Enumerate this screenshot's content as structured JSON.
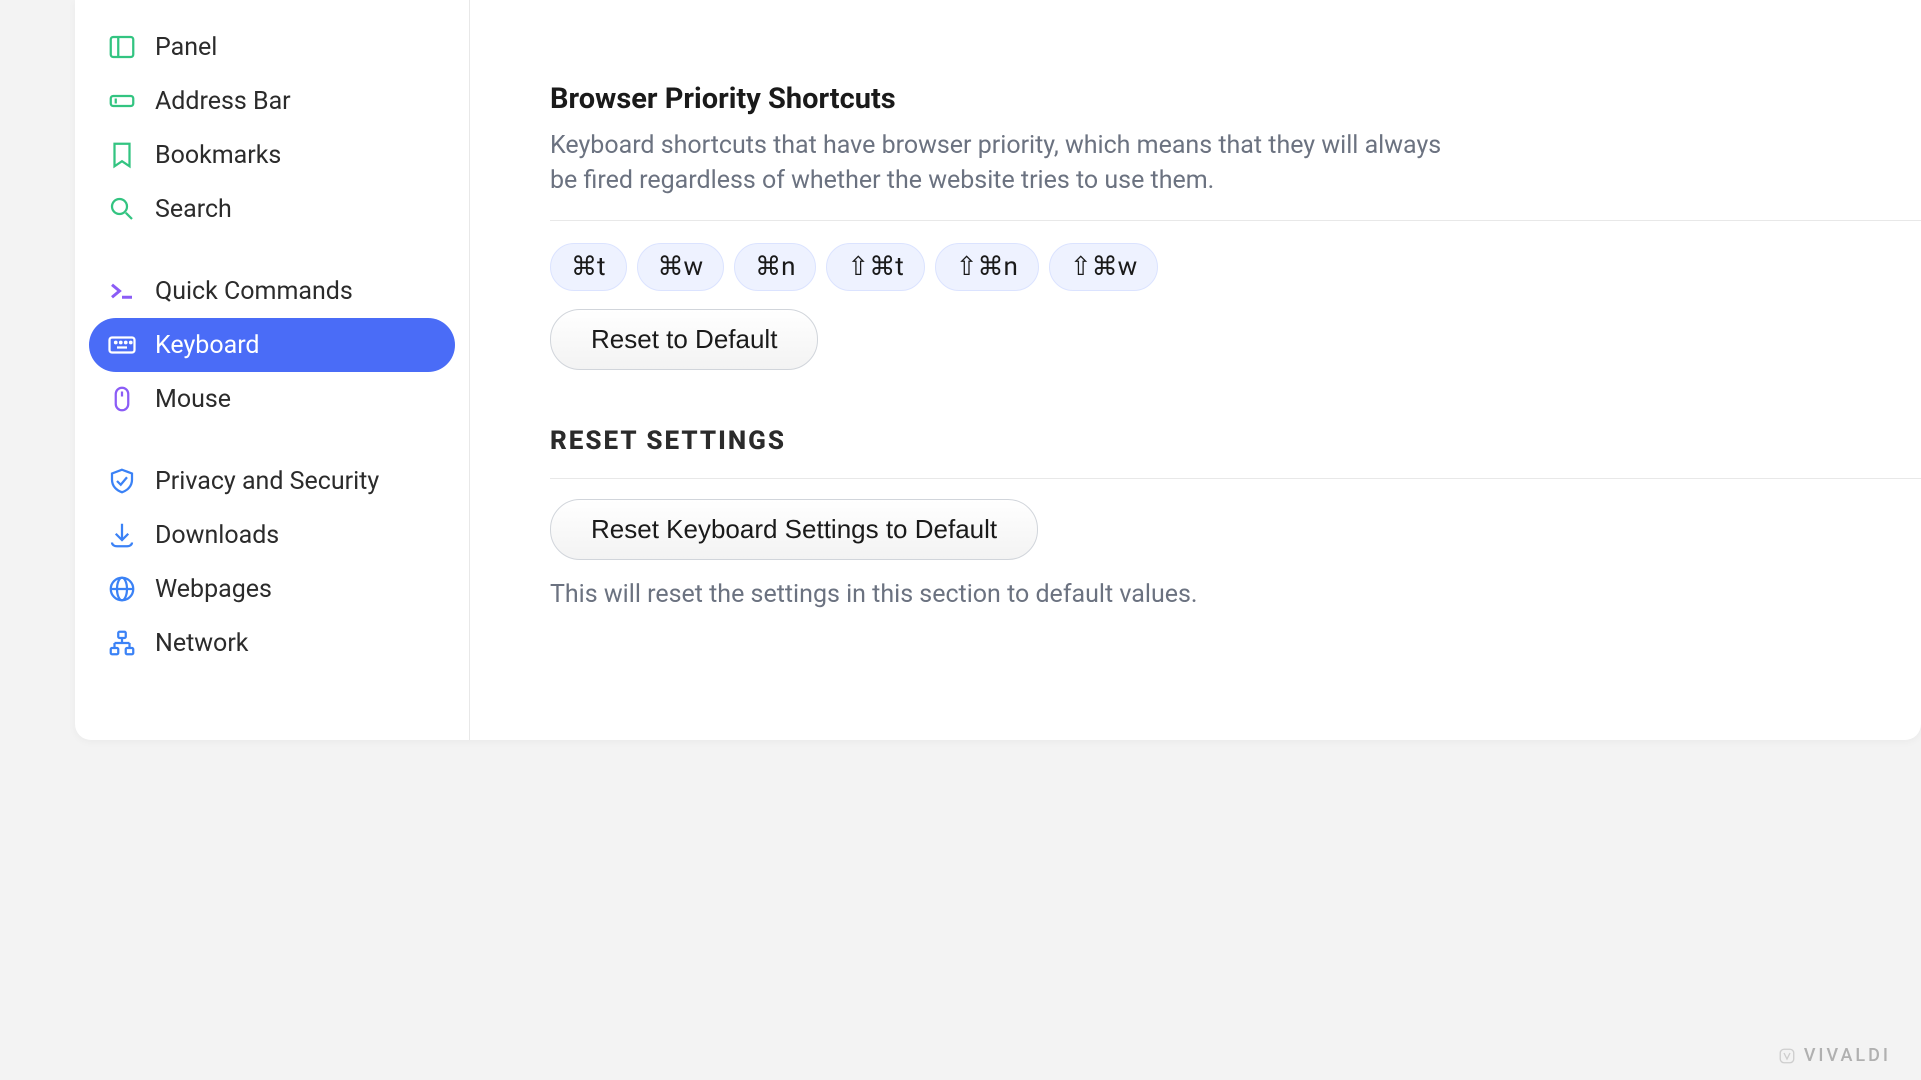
{
  "sidebar": {
    "items": [
      {
        "label": "Panel",
        "icon": "panel"
      },
      {
        "label": "Address Bar",
        "icon": "addressbar"
      },
      {
        "label": "Bookmarks",
        "icon": "bookmark"
      },
      {
        "label": "Search",
        "icon": "search"
      },
      {
        "label": "Quick Commands",
        "icon": "quick"
      },
      {
        "label": "Keyboard",
        "icon": "keyboard",
        "active": true
      },
      {
        "label": "Mouse",
        "icon": "mouse"
      },
      {
        "label": "Privacy and Security",
        "icon": "shield"
      },
      {
        "label": "Downloads",
        "icon": "download"
      },
      {
        "label": "Webpages",
        "icon": "globe"
      },
      {
        "label": "Network",
        "icon": "network"
      }
    ]
  },
  "main": {
    "priority": {
      "title": "Browser Priority Shortcuts",
      "desc": "Keyboard shortcuts that have browser priority, which means that they will always be fired regardless of whether the website tries to use them.",
      "shortcuts": [
        "⌘t",
        "⌘w",
        "⌘n",
        "⇧⌘t",
        "⇧⌘n",
        "⇧⌘w"
      ],
      "reset_btn": "Reset to Default"
    },
    "reset": {
      "heading": "RESET SETTINGS",
      "button": "Reset Keyboard Settings to Default",
      "desc": "This will reset the settings in this section to default values."
    }
  },
  "brand": "VIVALDI"
}
